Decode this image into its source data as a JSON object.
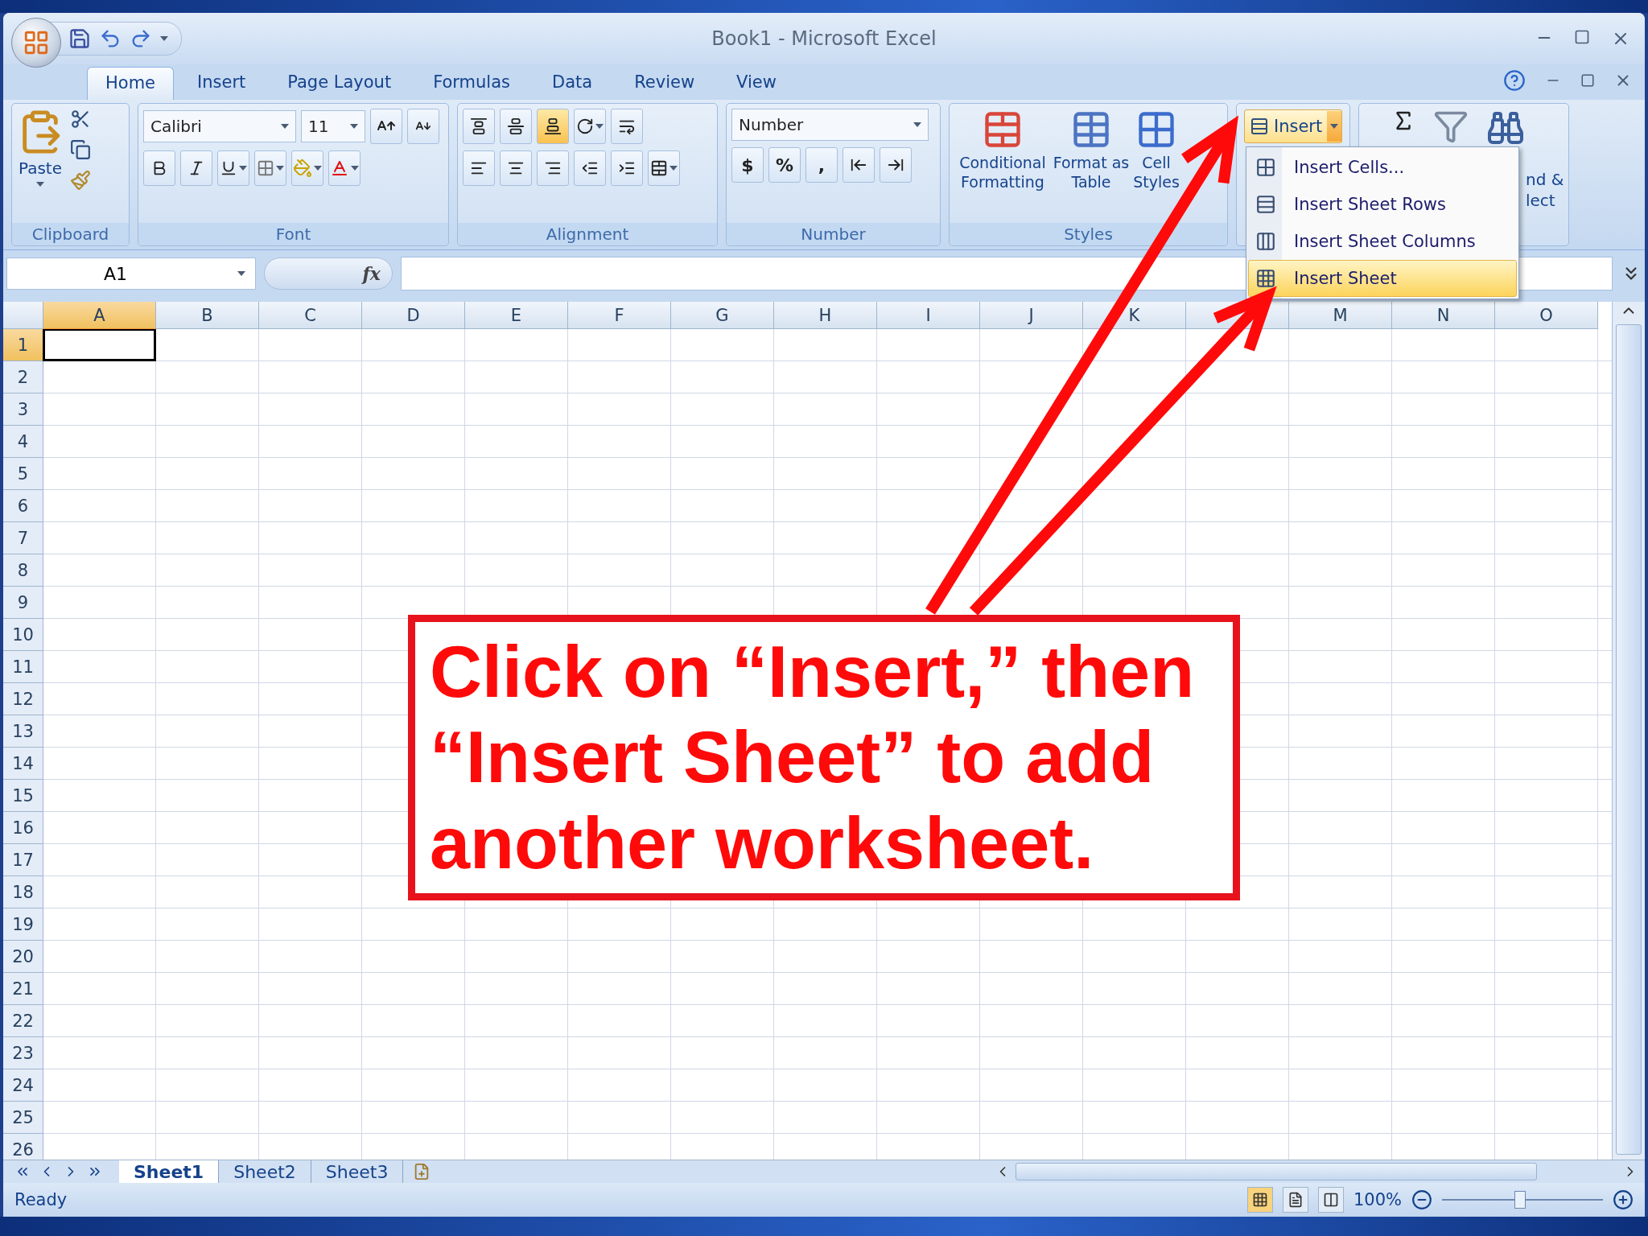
{
  "window": {
    "title": "Book1 - Microsoft Excel"
  },
  "tabs": [
    {
      "label": "Home",
      "selected": true
    },
    {
      "label": "Insert",
      "selected": false
    },
    {
      "label": "Page Layout",
      "selected": false
    },
    {
      "label": "Formulas",
      "selected": false
    },
    {
      "label": "Data",
      "selected": false
    },
    {
      "label": "Review",
      "selected": false
    },
    {
      "label": "View",
      "selected": false
    }
  ],
  "clipboard": {
    "title": "Clipboard",
    "paste": "Paste"
  },
  "font": {
    "title": "Font",
    "name": "Calibri",
    "size": "11"
  },
  "alignment": {
    "title": "Alignment",
    "vertical": [
      {
        "kind": "top",
        "selected": false
      },
      {
        "kind": "middle",
        "selected": false
      },
      {
        "kind": "bottom",
        "selected": true
      }
    ]
  },
  "number": {
    "title": "Number",
    "format": "Number",
    "symbols": [
      "$",
      "%",
      ","
    ]
  },
  "styles": {
    "title": "Styles",
    "buttons": [
      {
        "kind": "conditional",
        "label": "Conditional Formatting"
      },
      {
        "kind": "table",
        "label": "Format as Table"
      },
      {
        "kind": "cell",
        "label": "Cell Styles"
      }
    ]
  },
  "cells": {
    "insert": "Insert"
  },
  "editing": {
    "find_lines": [
      "nd &",
      "lect"
    ]
  },
  "insert_menu": [
    {
      "kind": "cells",
      "label": "Insert Cells...",
      "selected": false
    },
    {
      "kind": "rows",
      "label": "Insert Sheet Rows",
      "selected": false
    },
    {
      "kind": "columns",
      "label": "Insert Sheet Columns",
      "selected": false
    },
    {
      "kind": "sheet",
      "label": "Insert Sheet",
      "selected": true
    }
  ],
  "formula_bar": {
    "name_box": "A1",
    "fx": "fx"
  },
  "sheet": {
    "columns": [
      {
        "label": "A",
        "selected": true
      },
      {
        "label": "B",
        "selected": false
      },
      {
        "label": "C",
        "selected": false
      },
      {
        "label": "D",
        "selected": false
      },
      {
        "label": "E",
        "selected": false
      },
      {
        "label": "F",
        "selected": false
      },
      {
        "label": "G",
        "selected": false
      },
      {
        "label": "H",
        "selected": false
      },
      {
        "label": "I",
        "selected": false
      },
      {
        "label": "J",
        "selected": false
      },
      {
        "label": "K",
        "selected": false
      },
      {
        "selected": false
      },
      {
        "label": "M",
        "selected": false
      },
      {
        "label": "N",
        "selected": false
      },
      {
        "label": "O",
        "selected": false
      }
    ],
    "rows": [
      {
        "label": "1",
        "selected": true
      },
      {
        "label": "2",
        "selected": false
      },
      {
        "label": "3",
        "selected": false
      },
      {
        "label": "4",
        "selected": false
      },
      {
        "label": "5",
        "selected": false
      },
      {
        "label": "6",
        "selected": false
      },
      {
        "label": "7",
        "selected": false
      },
      {
        "label": "8",
        "selected": false
      },
      {
        "label": "9",
        "selected": false
      },
      {
        "label": "10",
        "selected": false
      },
      {
        "label": "11",
        "selected": false
      },
      {
        "label": "12",
        "selected": false
      },
      {
        "label": "13",
        "selected": false
      },
      {
        "label": "14",
        "selected": false
      },
      {
        "label": "15",
        "selected": false
      },
      {
        "label": "16",
        "selected": false
      },
      {
        "label": "17",
        "selected": false
      },
      {
        "label": "18",
        "selected": false
      },
      {
        "label": "19",
        "selected": false
      },
      {
        "label": "20",
        "selected": false
      },
      {
        "label": "21",
        "selected": false
      },
      {
        "label": "22",
        "selected": false
      },
      {
        "label": "23",
        "selected": false
      },
      {
        "label": "24",
        "selected": false
      },
      {
        "label": "25",
        "selected": false
      },
      {
        "label": "26",
        "selected": false
      }
    ]
  },
  "sheet_tabs": [
    {
      "label": "Sheet1",
      "selected": true
    },
    {
      "label": "Sheet2",
      "selected": false
    },
    {
      "label": "Sheet3",
      "selected": false
    }
  ],
  "status_bar": {
    "text": "Ready",
    "zoom": "100%"
  },
  "callout": {
    "lines": [
      "Click on “Insert,” then",
      "“Insert Sheet” to add",
      "another worksheet."
    ]
  }
}
